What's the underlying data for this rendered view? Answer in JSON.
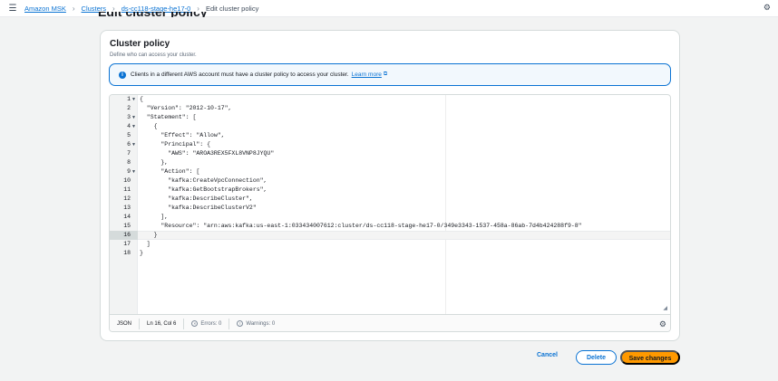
{
  "breadcrumb": {
    "items": [
      "Amazon MSK",
      "Clusters",
      "ds-cc118-stage-he17-0"
    ],
    "current": "Edit cluster policy"
  },
  "page_title": "Edit cluster policy",
  "container": {
    "title": "Cluster policy",
    "description": "Define who can access your cluster."
  },
  "alert": {
    "text": "Clients in a different AWS account must have a cluster policy to access your cluster.",
    "link": "Learn more"
  },
  "editor": {
    "active_line": 16,
    "lines": [
      "{",
      "  \"Version\": \"2012-10-17\",",
      "  \"Statement\": [",
      "    {",
      "      \"Effect\": \"Allow\",",
      "      \"Principal\": {",
      "        \"AWS\": \"AROA3REX5FXL8VNP8JYQU\"",
      "      },",
      "      \"Action\": [",
      "        \"kafka:CreateVpcConnection\",",
      "        \"kafka:GetBootstrapBrokers\",",
      "        \"kafka:DescribeCluster\",",
      "        \"kafka:DescribeClusterV2\"",
      "      ],",
      "      \"Resource\": \"arn:aws:kafka:us-east-1:033434007612:cluster/ds-cc118-stage-he17-0/349e3343-1537-458a-86ab-7d4b424288f9-8\"",
      "    }",
      "  ]",
      "}"
    ],
    "fold_lines": [
      1,
      3,
      4,
      6,
      9
    ]
  },
  "statusbar": {
    "language": "JSON",
    "position": "Ln 16, Col 6",
    "errors": "Errors: 0",
    "warnings": "Warnings: 0"
  },
  "actions": {
    "cancel": "Cancel",
    "delete": "Delete",
    "save": "Save changes"
  },
  "colors": {
    "accent": "#0972d3",
    "primary_button": "#ff9900"
  }
}
